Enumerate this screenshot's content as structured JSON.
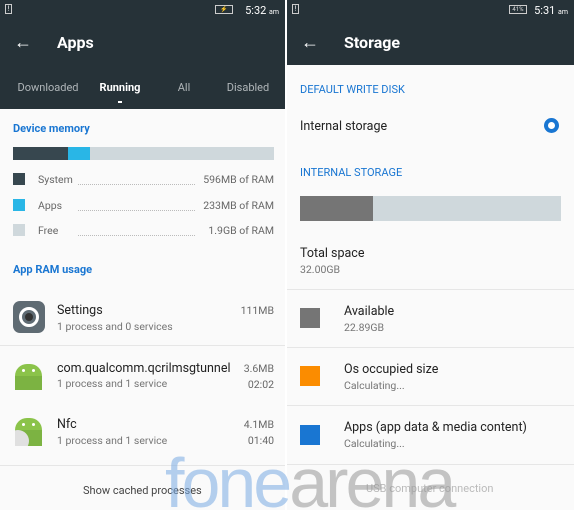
{
  "left": {
    "status": {
      "time": "5:32",
      "ampm": "am"
    },
    "title": "Apps",
    "tabs": [
      {
        "label": "Downloaded"
      },
      {
        "label": "Running",
        "active": true
      },
      {
        "label": "All"
      },
      {
        "label": "Disabled"
      }
    ],
    "device_memory": {
      "heading": "Device memory",
      "fractions": {
        "system": 0.21,
        "apps": 0.085
      },
      "legend": [
        {
          "label": "System",
          "value": "596MB of RAM",
          "color": "#37474f"
        },
        {
          "label": "Apps",
          "value": "233MB of RAM",
          "color": "#29b6e6"
        },
        {
          "label": "Free",
          "value": "1.9GB of RAM",
          "color": "#cfd8dc"
        }
      ]
    },
    "app_ram_heading": "App RAM usage",
    "apps": [
      {
        "name": "Settings",
        "sub": "1 process and 0 services",
        "size": "111MB",
        "time": "",
        "icon": "settings-gear-icon"
      },
      {
        "name": "com.qualcomm.qcrilmsgtunnel",
        "sub": "1 process and 1 service",
        "size": "3.6MB",
        "time": "02:02",
        "icon": "android-icon"
      },
      {
        "name": "Nfc",
        "sub": "1 process and 1 service",
        "size": "4.1MB",
        "time": "01:40",
        "icon": "android-nfc-icon"
      }
    ],
    "show_cached": "Show cached processes"
  },
  "right": {
    "status": {
      "time": "5:31",
      "ampm": "am",
      "battery": "41%"
    },
    "title": "Storage",
    "default_write_heading": "DEFAULT WRITE DISK",
    "internal_storage_option": "Internal storage",
    "internal_heading": "INTERNAL STORAGE",
    "used_fraction": 0.28,
    "total_label": "Total space",
    "total_value": "32.00GB",
    "items": [
      {
        "label": "Available",
        "value": "22.89GB",
        "color": "#757575"
      },
      {
        "label": "Os occupied size",
        "value": "Calculating...",
        "color": "#fb8c00"
      },
      {
        "label": "Apps (app data & media content)",
        "value": "Calculating...",
        "color": "#1976d2"
      }
    ],
    "usb": "USB computer connection"
  },
  "watermark": "fonearena"
}
